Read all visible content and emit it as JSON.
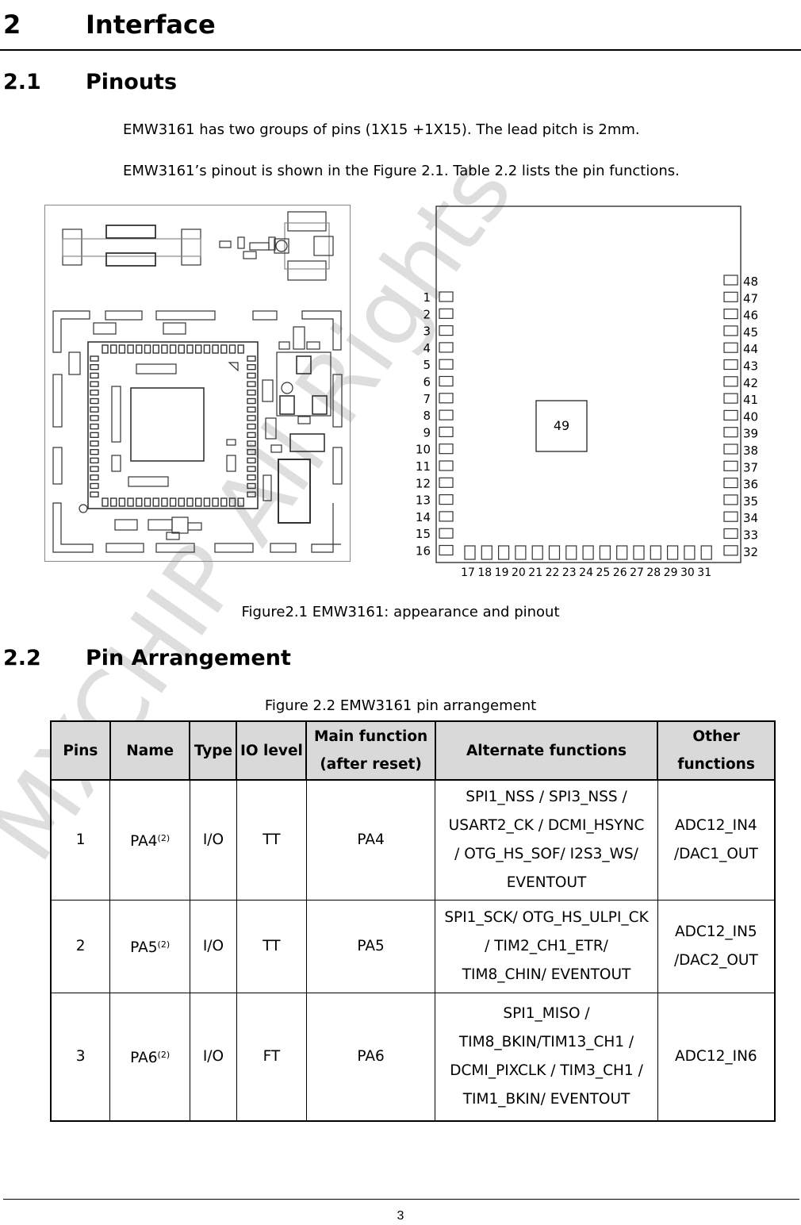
{
  "heading1": {
    "number": "2",
    "title": "Interface"
  },
  "section_pinouts": {
    "number": "2.1",
    "title": "Pinouts",
    "paragraphs": [
      "EMW3161 has two groups of pins (1X15 +1X15). The lead pitch is 2mm.",
      "EMW3161’s pinout is shown in the Figure 2.1. Table 2.2 lists the pin functions."
    ]
  },
  "figure1": {
    "caption": "Figure2.1 EMW3161: appearance and pinout",
    "pinout": {
      "left_pins": [
        "1",
        "2",
        "3",
        "4",
        "5",
        "6",
        "7",
        "8",
        "9",
        "10",
        "11",
        "12",
        "13",
        "14",
        "15",
        "16"
      ],
      "bottom_pins": [
        "17",
        "18",
        "19",
        "20",
        "21",
        "22",
        "23",
        "24",
        "25",
        "26",
        "27",
        "28",
        "29",
        "30",
        "31"
      ],
      "right_pins": [
        "48",
        "47",
        "46",
        "45",
        "44",
        "43",
        "42",
        "41",
        "40",
        "39",
        "38",
        "37",
        "36",
        "35",
        "34",
        "33",
        "32"
      ],
      "center_pad": "49"
    }
  },
  "section_arrangement": {
    "number": "2.2",
    "title": "Pin Arrangement",
    "table_caption": "Figure 2.2 EMW3161 pin arrangement",
    "headers": [
      "Pins",
      "Name",
      "Type",
      "IO level",
      "Main function (after reset)",
      "Alternate functions",
      "Other functions"
    ],
    "header_lines": {
      "main_1": "Main function",
      "main_2": "(after reset)",
      "other_1": "Other",
      "other_2": "functions"
    },
    "rows": [
      {
        "pin": "1",
        "name": "PA4",
        "note": "(2)",
        "type": "I/O",
        "io_level": "TT",
        "main": "PA4",
        "alternate": [
          "SPI1_NSS / SPI3_NSS /",
          "USART2_CK / DCMI_HSYNC",
          "/ OTG_HS_SOF/ I2S3_WS/",
          "EVENTOUT"
        ],
        "other": [
          "ADC12_IN4",
          "/DAC1_OUT"
        ]
      },
      {
        "pin": "2",
        "name": "PA5",
        "note": "(2)",
        "type": "I/O",
        "io_level": "TT",
        "main": "PA5",
        "alternate": [
          "SPI1_SCK/ OTG_HS_ULPI_CK",
          "/ TIM2_CH1_ETR/",
          "TIM8_CHIN/ EVENTOUT"
        ],
        "other": [
          "ADC12_IN5",
          "/DAC2_OUT"
        ]
      },
      {
        "pin": "3",
        "name": "PA6",
        "note": "(2)",
        "type": "I/O",
        "io_level": "FT",
        "main": "PA6",
        "alternate": [
          "SPI1_MISO /",
          "TIM8_BKIN/TIM13_CH1 /",
          "DCMI_PIXCLK / TIM3_CH1 /",
          "TIM1_BKIN/ EVENTOUT"
        ],
        "other": [
          "ADC12_IN6"
        ]
      }
    ]
  },
  "watermark": "MXCHIP All Rights",
  "footer": {
    "page_number": "3"
  }
}
